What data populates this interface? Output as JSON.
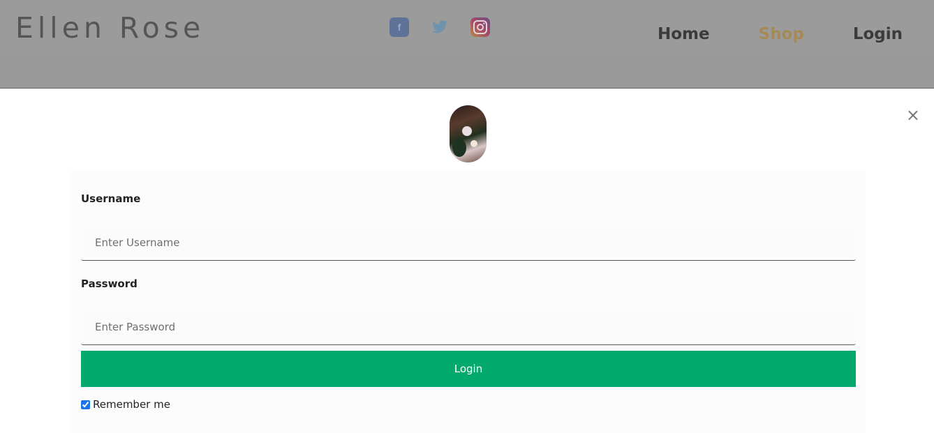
{
  "header": {
    "brand": "Ellen Rose",
    "socials": [
      {
        "name": "facebook-icon",
        "glyph": "f"
      },
      {
        "name": "twitter-icon"
      },
      {
        "name": "instagram-icon"
      }
    ],
    "nav": [
      {
        "label": "Home",
        "active": false
      },
      {
        "label": "Shop",
        "active": true
      },
      {
        "label": "Login",
        "active": false
      }
    ]
  },
  "modal": {
    "close_glyph": "×",
    "username_label": "Username",
    "username_placeholder": "Enter Username",
    "username_value": "",
    "password_label": "Password",
    "password_placeholder": "Enter Password",
    "password_value": "",
    "login_button": "Login",
    "remember_label": "Remember me",
    "remember_checked": true
  },
  "colors": {
    "accent_green": "#04aa6d",
    "nav_active": "#a58a56",
    "overlay": "#999999"
  }
}
